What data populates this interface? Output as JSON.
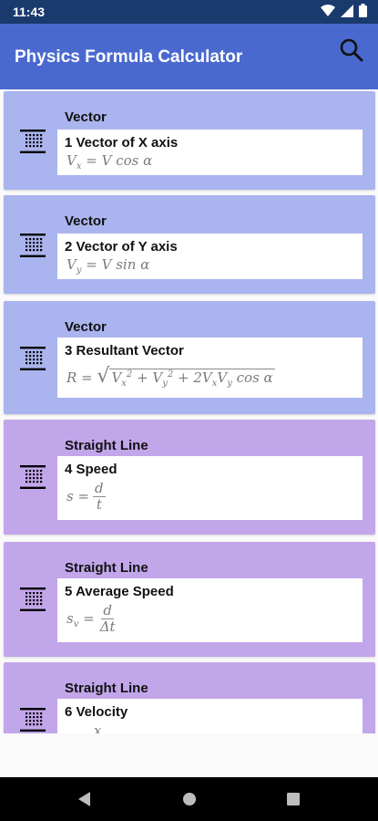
{
  "status_bar": {
    "time": "11:43"
  },
  "app_bar": {
    "title": "Physics Formula Calculator",
    "icon": "search-icon"
  },
  "cards": [
    {
      "category": "Vector",
      "title": "1 Vector of X axis",
      "formula": "Vx = V cos α"
    },
    {
      "category": "Vector",
      "title": "2 Vector of Y axis",
      "formula": "Vy = V sin α"
    },
    {
      "category": "Vector",
      "title": "3 Resultant Vector",
      "formula": "R = √(Vx² + Vy² + 2VxVy cos α)"
    },
    {
      "category": "Straight Line",
      "title": "4 Speed",
      "formula": "s = d / t"
    },
    {
      "category": "Straight Line",
      "title": "5 Average Speed",
      "formula": "sv = d / Δt"
    },
    {
      "category": "Straight Line",
      "title": "6 Velocity",
      "formula": "x"
    }
  ],
  "colors": {
    "status_bar": "#1a3a6e",
    "app_bar": "#4a69cf",
    "vector_card": "#aab4ee",
    "straight_line_card": "#c2a6ea"
  },
  "nav_bar": {
    "icons": [
      "back-icon",
      "home-icon",
      "recents-icon"
    ]
  }
}
